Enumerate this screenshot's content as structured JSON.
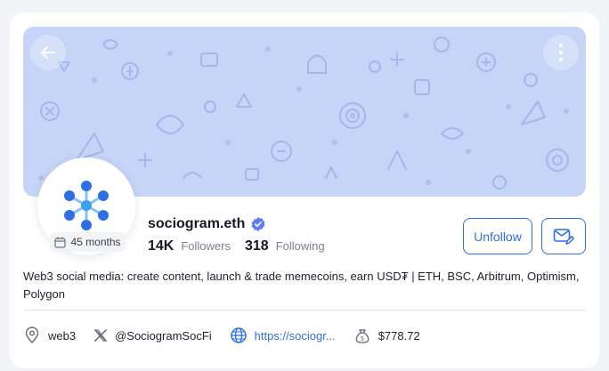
{
  "profile": {
    "name": "sociogram.eth",
    "verified": true,
    "age_badge": "45 months",
    "followers_count": "14K",
    "followers_label": "Followers",
    "following_count": "318",
    "following_label": "Following",
    "bio": "Web3 social media: create content, launch & trade memecoins, earn USD₮ | ETH, BSC, Arbitrum, Optimism, Polygon"
  },
  "actions": {
    "unfollow_label": "Unfollow"
  },
  "meta": {
    "tag": "web3",
    "x_handle": "@SociogramSocFi",
    "website": "https://sociogr...",
    "balance": "$778.72"
  },
  "colors": {
    "accent": "#2f6fe4",
    "banner": "#c6d4f7",
    "verified_badge": "#5b7cf6"
  }
}
